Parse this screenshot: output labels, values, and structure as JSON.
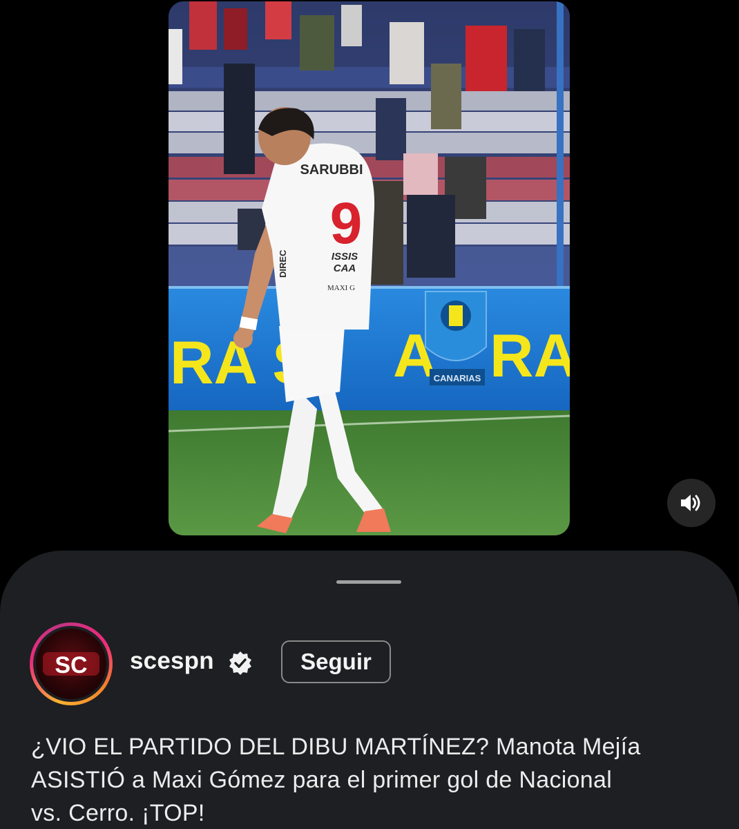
{
  "video": {
    "jersey_name": "SARUBBI",
    "jersey_number": "9",
    "sponsor_line1": "ISSIS",
    "sponsor_line2": "CAA",
    "sponsor_line3": "MAXI G",
    "sleeve_text": "DIREC",
    "board_left": "RA S",
    "board_mid": "A",
    "board_right": "RA",
    "crest_label": "CANARIAS"
  },
  "controls": {
    "mute_icon": "speaker-icon"
  },
  "post": {
    "avatar_text": "SC",
    "username": "scespn",
    "verified_icon": "verified-badge-icon",
    "follow_label": "Seguir",
    "caption_lines": [
      "¿VIO EL PARTIDO DEL DIBU MARTÍNEZ? Manota Mejía",
      "ASISTIÓ a Maxi Gómez para el primer gol de Nacional",
      "vs. Cerro. ¡TOP!"
    ]
  },
  "colors": {
    "sheet_bg": "#1d1f22",
    "text": "#f4f4f4",
    "ad_board": "#1f7fd6",
    "ad_text": "#f5e61c",
    "pitch": "#4d8a3a"
  }
}
